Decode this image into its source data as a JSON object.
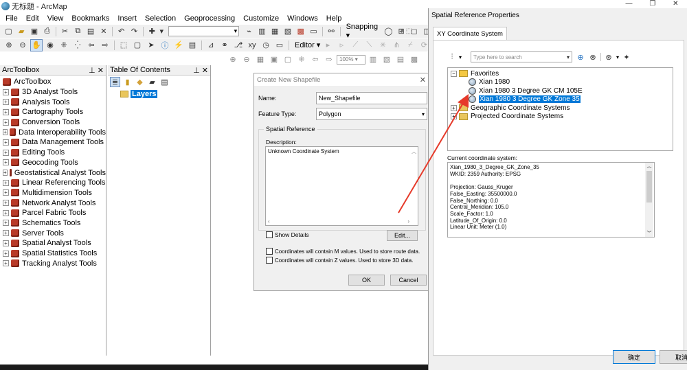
{
  "app": {
    "window_title": "无标题 - ArcMap"
  },
  "menu": [
    "File",
    "Edit",
    "View",
    "Bookmarks",
    "Insert",
    "Selection",
    "Geoprocessing",
    "Customize",
    "Windows",
    "Help"
  ],
  "toolbar": {
    "snapping_label": "Snapping",
    "editor_label": "Editor",
    "zoom_value": "100%"
  },
  "arctoolbox": {
    "title": "ArcToolbox",
    "root": "ArcToolbox",
    "tools": [
      "3D Analyst Tools",
      "Analysis Tools",
      "Cartography Tools",
      "Conversion Tools",
      "Data Interoperability Tools",
      "Data Management Tools",
      "Editing Tools",
      "Geocoding Tools",
      "Geostatistical Analyst Tools",
      "Linear Referencing Tools",
      "Multidimension Tools",
      "Network Analyst Tools",
      "Parcel Fabric Tools",
      "Schematics Tools",
      "Server Tools",
      "Spatial Analyst Tools",
      "Spatial Statistics Tools",
      "Tracking Analyst Tools"
    ]
  },
  "toc": {
    "title": "Table Of Contents",
    "layers": "Layers"
  },
  "shapefile_dialog": {
    "title": "Create New Shapefile",
    "name_label": "Name:",
    "name_value": "New_Shapefile",
    "feature_type_label": "Feature Type:",
    "feature_type_value": "Polygon",
    "group_label": "Spatial Reference",
    "description_label": "Description:",
    "description_value": "Unknown Coordinate System",
    "show_details": "Show Details",
    "edit_button": "Edit...",
    "m_values": "Coordinates will contain M values. Used to store route data.",
    "z_values": "Coordinates will contain Z values. Used to store 3D data.",
    "ok": "OK",
    "cancel": "Cancel"
  },
  "spatial_ref": {
    "title": "Spatial Reference Properties",
    "tab": "XY Coordinate System",
    "search_placeholder": "Type here to search",
    "favorites": "Favorites",
    "favorite_items": [
      "Xian 1980",
      "Xian 1980 3 Degree GK CM 105E",
      "Xian 1980 3 Degree GK Zone 35"
    ],
    "geographic": "Geographic Coordinate Systems",
    "projected": "Projected Coordinate Systems",
    "current_label": "Current coordinate system:",
    "current_lines": [
      "Xian_1980_3_Degree_GK_Zone_35",
      "WKID: 2359 Authority: EPSG",
      "",
      "Projection: Gauss_Kruger",
      "False_Easting: 35500000.0",
      "False_Northing: 0.0",
      "Central_Meridian: 105.0",
      "Scale_Factor: 1.0",
      "Latitude_Of_Origin: 0.0",
      "Linear Unit: Meter (1.0)"
    ],
    "ok": "确定",
    "cancel": "取消"
  },
  "colors": {
    "selection": "#0078d7",
    "arrow": "#e63a2a"
  }
}
